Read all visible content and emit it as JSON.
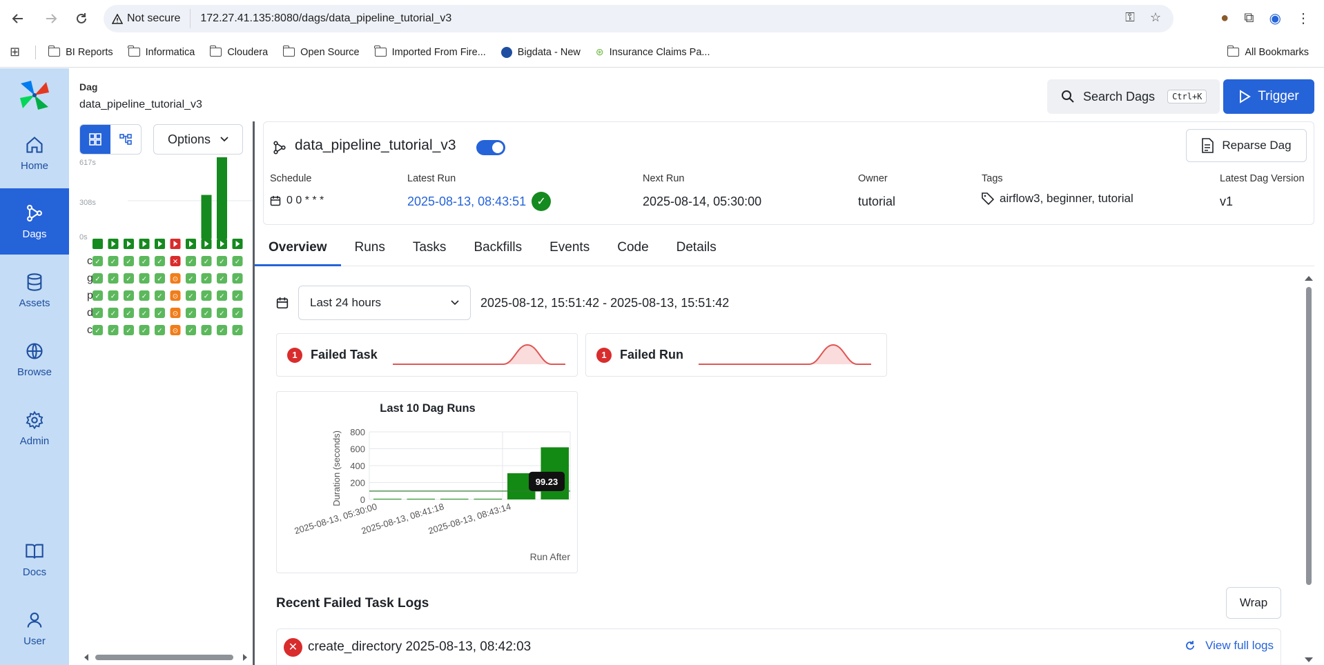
{
  "browser": {
    "security_label": "Not secure",
    "url": "172.27.41.135:8080/dags/data_pipeline_tutorial_v3",
    "bookmarks": [
      "BI Reports",
      "Informatica",
      "Cloudera",
      "Open Source",
      "Imported From Fire...",
      "Bigdata - New",
      "Insurance Claims Pa..."
    ],
    "all_bookmarks": "All Bookmarks"
  },
  "nav": {
    "items": [
      {
        "label": "Home",
        "icon": "home-icon"
      },
      {
        "label": "Dags",
        "icon": "dags-icon"
      },
      {
        "label": "Assets",
        "icon": "database-icon"
      },
      {
        "label": "Browse",
        "icon": "globe-icon"
      },
      {
        "label": "Admin",
        "icon": "gear-icon"
      },
      {
        "label": "Docs",
        "icon": "book-icon"
      },
      {
        "label": "User",
        "icon": "user-icon"
      }
    ],
    "active": "Dags"
  },
  "breadcrumb": {
    "label": "Dag",
    "value": "data_pipeline_tutorial_v3"
  },
  "header": {
    "search_label": "Search Dags",
    "search_shortcut": "Ctrl+K",
    "trigger_label": "Trigger"
  },
  "grid": {
    "options_label": "Options",
    "axis": [
      "617s",
      "308s",
      "0s"
    ],
    "durations": [
      0,
      0,
      0,
      0,
      0,
      0,
      0,
      0.52,
      1.0,
      0
    ],
    "run_states": [
      "success",
      "success",
      "success",
      "success",
      "success",
      "failed",
      "success",
      "success",
      "success",
      "success"
    ],
    "task_labels": [
      "c...",
      "g...",
      "p...",
      "d...",
      "c..."
    ],
    "task_states": [
      [
        "success",
        "success",
        "success",
        "success",
        "success",
        "failed",
        "success",
        "success",
        "success",
        "success"
      ],
      [
        "success",
        "success",
        "success",
        "success",
        "success",
        "upstream_failed",
        "success",
        "success",
        "success",
        "success"
      ],
      [
        "success",
        "success",
        "success",
        "success",
        "success",
        "upstream_failed",
        "success",
        "success",
        "success",
        "success"
      ],
      [
        "success",
        "success",
        "success",
        "success",
        "success",
        "upstream_failed",
        "success",
        "success",
        "success",
        "success"
      ],
      [
        "success",
        "success",
        "success",
        "success",
        "success",
        "upstream_failed",
        "success",
        "success",
        "success",
        "success"
      ]
    ]
  },
  "dag": {
    "title": "data_pipeline_tutorial_v3",
    "reparse_label": "Reparse Dag",
    "schedule_label": "Schedule",
    "schedule_value": "0 0 * * *",
    "latest_run_label": "Latest Run",
    "latest_run_value": "2025-08-13, 08:43:51",
    "next_run_label": "Next Run",
    "next_run_value": "2025-08-14, 05:30:00",
    "owner_label": "Owner",
    "owner_value": "tutorial",
    "tags_label": "Tags",
    "tags_value": "airflow3, beginner, tutorial",
    "version_label": "Latest Dag Version",
    "version_value": "v1"
  },
  "tabs": [
    "Overview",
    "Runs",
    "Tasks",
    "Backfills",
    "Events",
    "Code",
    "Details"
  ],
  "overview": {
    "range_select": "Last 24 hours",
    "range_text": "2025-08-12, 15:51:42 - 2025-08-13, 15:51:42",
    "failed_task": {
      "count": "1",
      "label": "Failed Task"
    },
    "failed_run": {
      "count": "1",
      "label": "Failed Run"
    },
    "logs_title": "Recent Failed Task Logs",
    "wrap_label": "Wrap",
    "log_entry": "create_directory 2025-08-13, 08:42:03",
    "view_logs": "View full logs"
  },
  "colors": {
    "accent": "#2563d9",
    "success": "#158a1e",
    "failed": "#d92c2c",
    "upstream_failed": "#f07d1a",
    "nav_bg": "#c4dcf5"
  },
  "chart_data": {
    "type": "bar",
    "title": "Last 10 Dag Runs",
    "xlabel": "Run After",
    "ylabel": "Duration (seconds)",
    "categories": [
      "2025-08-13, 05:30:00",
      "",
      "2025-08-13, 08:41:18",
      "",
      "2025-08-13, 08:43:14",
      ""
    ],
    "x_tick_labels": [
      "2025-08-13, 05:30:00",
      "2025-08-13, 08:41:18",
      "2025-08-13, 08:43:14"
    ],
    "values": [
      3,
      2,
      0,
      1,
      310,
      617
    ],
    "yticks": [
      0,
      200,
      400,
      600,
      800
    ],
    "ylim": [
      0,
      800
    ],
    "mean_line": 99.23,
    "mean_label": "99.23",
    "grid": true
  }
}
